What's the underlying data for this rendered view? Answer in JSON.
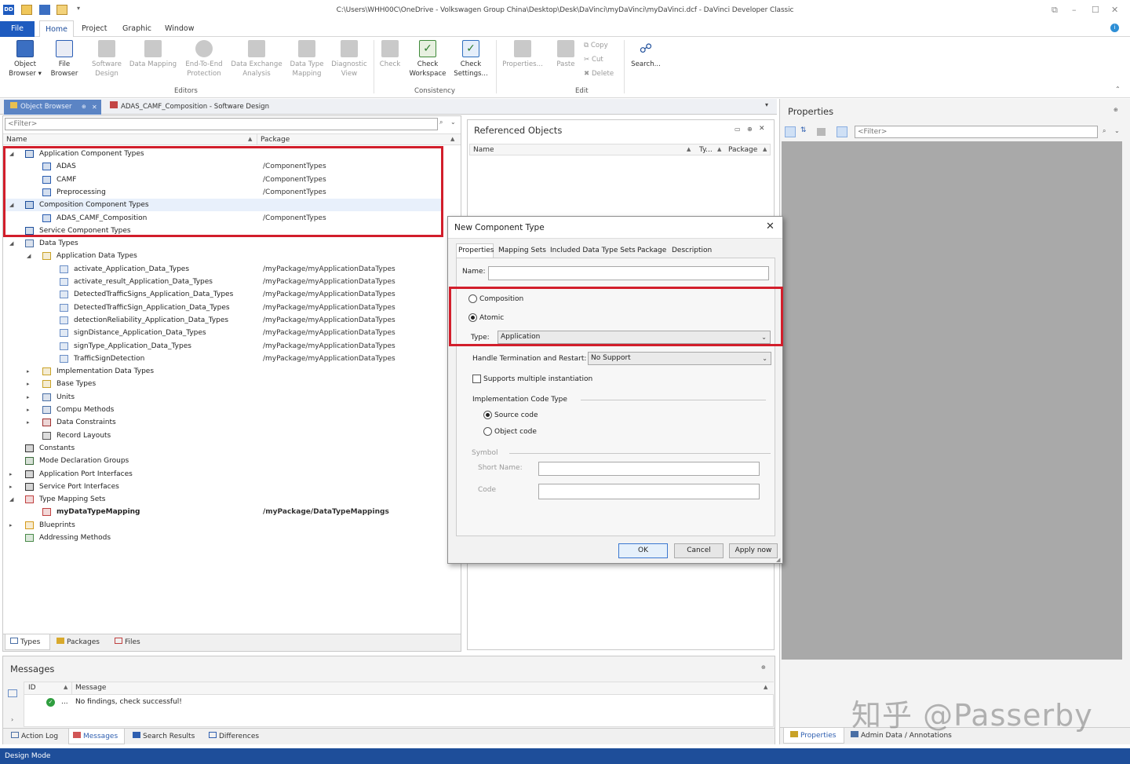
{
  "window": {
    "title": "C:\\Users\\WHH00C\\OneDrive - Volkswagen Group China\\Desktop\\Desk\\DaVinci\\myDaVinci\\myDaVinci.dcf - DaVinci Developer Classic",
    "app_logo": "DD"
  },
  "menu": {
    "file": "File",
    "home": "Home",
    "project": "Project",
    "graphic": "Graphic",
    "window": "Window"
  },
  "ribbon": {
    "object_browser": "Object\nBrowser ▾",
    "file_browser": "File\nBrowser",
    "software_design": "Software\nDesign",
    "data_mapping": "Data Mapping",
    "end_to_end": "End-To-End\nProtection",
    "data_exchange": "Data Exchange\nAnalysis",
    "data_type_mapping": "Data Type\nMapping",
    "diagnostic_view": "Diagnostic\nView",
    "check": "Check",
    "check_workspace": "Check\nWorkspace",
    "check_settings": "Check\nSettings...",
    "properties": "Properties...",
    "paste": "Paste",
    "copy": "Copy",
    "cut": "Cut",
    "delete": "Delete",
    "search": "Search...",
    "group_editors": "Editors",
    "group_consistency": "Consistency",
    "group_edit": "Edit"
  },
  "doc_tabs": {
    "object_browser": "Object Browser",
    "pin": "⊕",
    "close": "✕",
    "software_design": "ADAS_CAMF_Composition - Software Design"
  },
  "object_browser": {
    "filter_placeholder": "<Filter>",
    "col_name": "Name",
    "col_package": "Package",
    "tree": [
      {
        "label": "Application Component Types",
        "package": "",
        "level": 0,
        "twisty": "◢",
        "icon_color": "#1d4f9c"
      },
      {
        "label": "ADAS",
        "package": "/ComponentTypes",
        "level": 1,
        "twisty": "",
        "icon_color": "#2a5db0"
      },
      {
        "label": "CAMF",
        "package": "/ComponentTypes",
        "level": 1,
        "twisty": "",
        "icon_color": "#2a5db0"
      },
      {
        "label": "Preprocessing",
        "package": "/ComponentTypes",
        "level": 1,
        "twisty": "",
        "icon_color": "#2a5db0"
      },
      {
        "label": "Composition Component Types",
        "package": "",
        "level": 0,
        "twisty": "◢",
        "icon_color": "#1d4f9c"
      },
      {
        "label": "ADAS_CAMF_Composition",
        "package": "/ComponentTypes",
        "level": 1,
        "twisty": "",
        "icon_color": "#2a5db0"
      },
      {
        "label": "Service Component Types",
        "package": "",
        "level": 0,
        "twisty": "",
        "icon_color": "#1d4f9c"
      },
      {
        "label": "Data Types",
        "package": "",
        "level": 0,
        "twisty": "◢",
        "icon_color": "#4a6fa5"
      },
      {
        "label": "Application Data Types",
        "package": "",
        "level": 1,
        "twisty": "◢",
        "icon_color": "#c9a227"
      },
      {
        "label": "activate_Application_Data_Types",
        "package": "/myPackage/myApplicationDataTypes",
        "level": 2,
        "twisty": "",
        "icon_color": "#6b8fc7"
      },
      {
        "label": "activate_result_Application_Data_Types",
        "package": "/myPackage/myApplicationDataTypes",
        "level": 2,
        "twisty": "",
        "icon_color": "#6b8fc7"
      },
      {
        "label": "DetectedTrafficSigns_Application_Data_Types",
        "package": "/myPackage/myApplicationDataTypes",
        "level": 2,
        "twisty": "",
        "icon_color": "#6b8fc7"
      },
      {
        "label": "DetectedTrafficSign_Application_Data_Types",
        "package": "/myPackage/myApplicationDataTypes",
        "level": 2,
        "twisty": "",
        "icon_color": "#6b8fc7"
      },
      {
        "label": "detectionReliability_Application_Data_Types",
        "package": "/myPackage/myApplicationDataTypes",
        "level": 2,
        "twisty": "",
        "icon_color": "#6b8fc7"
      },
      {
        "label": "signDistance_Application_Data_Types",
        "package": "/myPackage/myApplicationDataTypes",
        "level": 2,
        "twisty": "",
        "icon_color": "#6b8fc7"
      },
      {
        "label": "signType_Application_Data_Types",
        "package": "/myPackage/myApplicationDataTypes",
        "level": 2,
        "twisty": "",
        "icon_color": "#6b8fc7"
      },
      {
        "label": "TrafficSignDetection",
        "package": "/myPackage/myApplicationDataTypes",
        "level": 2,
        "twisty": "",
        "icon_color": "#6b8fc7"
      },
      {
        "label": "Implementation Data Types",
        "package": "",
        "level": 1,
        "twisty": "▸",
        "icon_color": "#c9a227"
      },
      {
        "label": "Base Types",
        "package": "",
        "level": 1,
        "twisty": "▸",
        "icon_color": "#c9a227"
      },
      {
        "label": "Units",
        "package": "",
        "level": 1,
        "twisty": "▸",
        "icon_color": "#4a6fa5"
      },
      {
        "label": "Compu Methods",
        "package": "",
        "level": 1,
        "twisty": "▸",
        "icon_color": "#4a6fa5"
      },
      {
        "label": "Data Constraints",
        "package": "",
        "level": 1,
        "twisty": "▸",
        "icon_color": "#a03030"
      },
      {
        "label": "Record Layouts",
        "package": "",
        "level": 1,
        "twisty": "",
        "icon_color": "#555555"
      },
      {
        "label": "Constants",
        "package": "",
        "level": 0,
        "twisty": "",
        "icon_color": "#333333"
      },
      {
        "label": "Mode Declaration Groups",
        "package": "",
        "level": 0,
        "twisty": "",
        "icon_color": "#3a6a3a"
      },
      {
        "label": "Application Port Interfaces",
        "package": "",
        "level": 0,
        "twisty": "▸",
        "icon_color": "#333333"
      },
      {
        "label": "Service Port Interfaces",
        "package": "",
        "level": 0,
        "twisty": "▸",
        "icon_color": "#333333"
      },
      {
        "label": "Type Mapping Sets",
        "package": "",
        "level": 0,
        "twisty": "◢",
        "icon_color": "#c04040"
      },
      {
        "label": "myDataTypeMapping",
        "package": "/myPackage/DataTypeMappings",
        "level": 1,
        "twisty": "",
        "icon_color": "#c04040",
        "bold": true
      },
      {
        "label": "Blueprints",
        "package": "",
        "level": 0,
        "twisty": "▸",
        "icon_color": "#d59a1a"
      },
      {
        "label": "Addressing Methods",
        "package": "",
        "level": 0,
        "twisty": "",
        "icon_color": "#4a8a4a"
      }
    ],
    "bottom_tabs": [
      "Types",
      "Packages",
      "Files"
    ]
  },
  "referenced_objects": {
    "title": "Referenced Objects",
    "col_name": "Name",
    "col_type": "Ty...",
    "col_package": "Package"
  },
  "properties_panel": {
    "title": "Properties",
    "filter_placeholder": "<Filter>",
    "bottom_tabs": [
      "Properties",
      "Admin Data / Annotations"
    ]
  },
  "messages": {
    "title": "Messages",
    "col_id": "ID",
    "col_message": "Message",
    "row_id": "...",
    "row_message": "No findings, check successful!",
    "bottom_tabs": [
      "Action Log",
      "Messages",
      "Search Results",
      "Differences"
    ]
  },
  "dialog": {
    "title": "New Component Type",
    "close": "✕",
    "tabs": [
      "Properties",
      "Mapping Sets",
      "Included Data Type Sets",
      "Package",
      "Description"
    ],
    "name_label": "Name:",
    "name_value": "",
    "composition_label": "Composition",
    "atomic_label": "Atomic",
    "type_label": "Type:",
    "type_value": "Application",
    "handle_label": "Handle Termination and Restart:",
    "handle_value": "No Support",
    "multi_inst_label": "Supports multiple instantiation",
    "impl_code_label": "Implementation Code Type",
    "source_code_label": "Source code",
    "object_code_label": "Object code",
    "symbol_label": "Symbol",
    "short_name_label": "Short Name:",
    "code_label": "Code",
    "ok": "OK",
    "cancel": "Cancel",
    "apply": "Apply now"
  },
  "status_bar": {
    "mode": "Design Mode"
  },
  "watermark": "知乎 @Passerby",
  "colors": {
    "accent": "#1e5bbf",
    "highlight_box": "#d21e2b",
    "status_bar": "#1e4e9a"
  }
}
